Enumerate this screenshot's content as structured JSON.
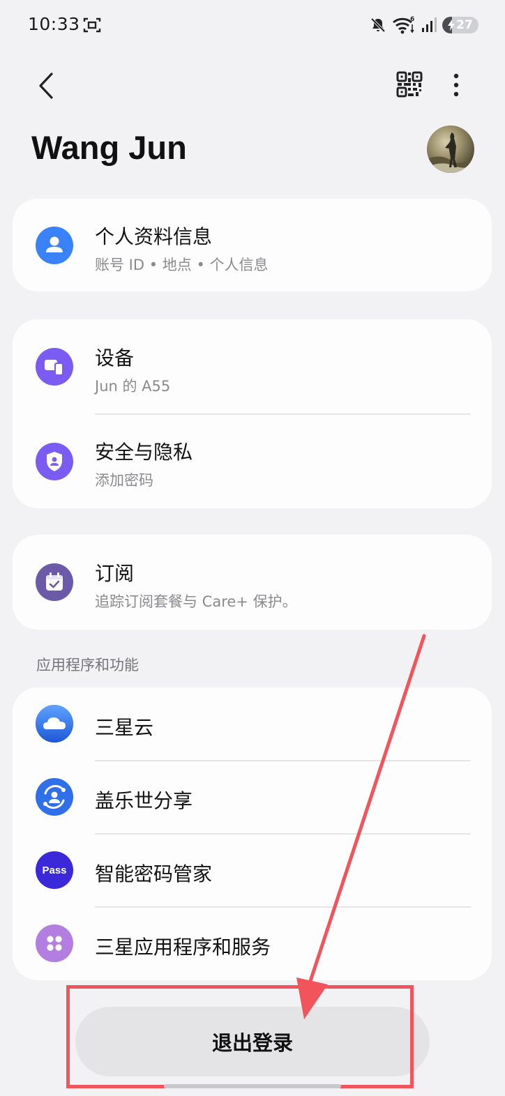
{
  "status_bar": {
    "time": "10:33",
    "battery_level": "27",
    "battery_fraction": 0.27
  },
  "header": {
    "title": "Wang Jun"
  },
  "profile_card": {
    "title": "个人资料信息",
    "subtitle": "账号 ID • 地点 • 个人信息"
  },
  "device_card": {
    "items": [
      {
        "title": "设备",
        "subtitle": "Jun 的 A55"
      },
      {
        "title": "安全与隐私",
        "subtitle": "添加密码"
      }
    ]
  },
  "subscription_card": {
    "title": "订阅",
    "subtitle": "追踪订阅套餐与 Care+ 保护。"
  },
  "apps_section": {
    "label": "应用程序和功能",
    "items": [
      {
        "title": "三星云"
      },
      {
        "title": "盖乐世分享"
      },
      {
        "title": "智能密码管家",
        "icon_text": "Pass"
      },
      {
        "title": "三星应用程序和服务"
      }
    ]
  },
  "logout": {
    "label": "退出登录"
  },
  "colors": {
    "background": "#f2f2f4",
    "card": "#fdfdfe",
    "profile_icon": "#3a82f7",
    "device_icon": "#7b5cf2",
    "subscription_icon": "#6a5aa8",
    "cloud_icon": "#2f6fea",
    "share_icon": "#2f6fea",
    "pass_icon": "#3b28d8",
    "services_icon": "#b27ee0",
    "annotation": "#f2545b"
  },
  "icons": {
    "back": "chevron-left-icon",
    "qr": "qr-code-icon",
    "more": "more-vertical-icon",
    "profile": "person-icon",
    "device": "devices-icon",
    "security": "shield-person-icon",
    "subscription": "calendar-check-icon",
    "cloud": "cloud-icon",
    "share": "quick-share-icon",
    "pass": "pass-icon",
    "services": "apps-grid-icon"
  }
}
